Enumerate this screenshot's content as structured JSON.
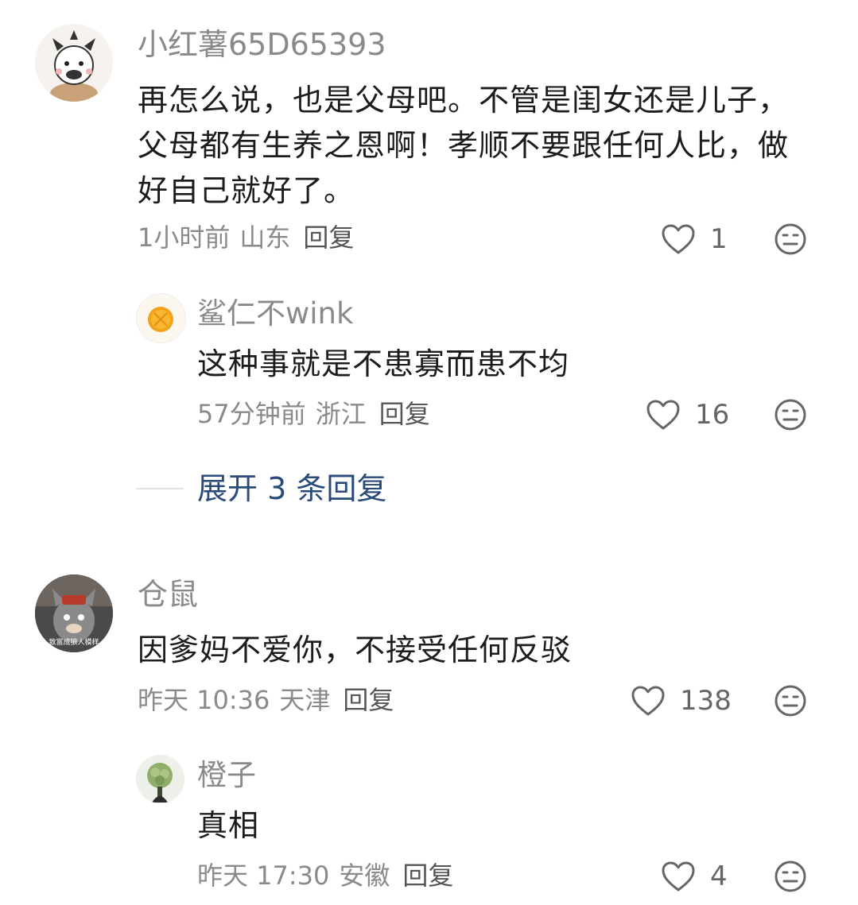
{
  "comments": [
    {
      "username": "小红薯65D65393",
      "content": "再怎么说，也是父母吧。不管是闺女还是儿子，父母都有生养之恩啊！孝顺不要跟任何人比，做好自己就好了。",
      "time": "1小时前",
      "location": "山东",
      "reply_label": "回复",
      "likes": "1",
      "avatar_icon": "cartoon-cat-avatar",
      "replies": [
        {
          "username": "鲨仁不wink",
          "content": "这种事就是不患寡而患不均",
          "time": "57分钟前",
          "location": "浙江",
          "reply_label": "回复",
          "likes": "16",
          "avatar_icon": "orange-fruit-avatar"
        }
      ],
      "expand_label": "展开 3 条回复"
    },
    {
      "username": "仓鼠",
      "content": "因爹妈不爱你，不接受任何反驳",
      "time": "昨天 10:36",
      "location": "天津",
      "reply_label": "回复",
      "likes": "138",
      "avatar_icon": "grey-wolf-avatar",
      "avatar_caption": "致富成狼人模样",
      "replies": [
        {
          "username": "橙子",
          "content": "真相",
          "time": "昨天 17:30",
          "location": "安徽",
          "reply_label": "回复",
          "likes": "4",
          "avatar_icon": "green-bouquet-avatar"
        }
      ]
    }
  ],
  "colors": {
    "username": "#8a8a8a",
    "content": "#1c1c1c",
    "meta": "#8a8a8a",
    "expand": "#2a4a7a",
    "icon": "#666666"
  }
}
